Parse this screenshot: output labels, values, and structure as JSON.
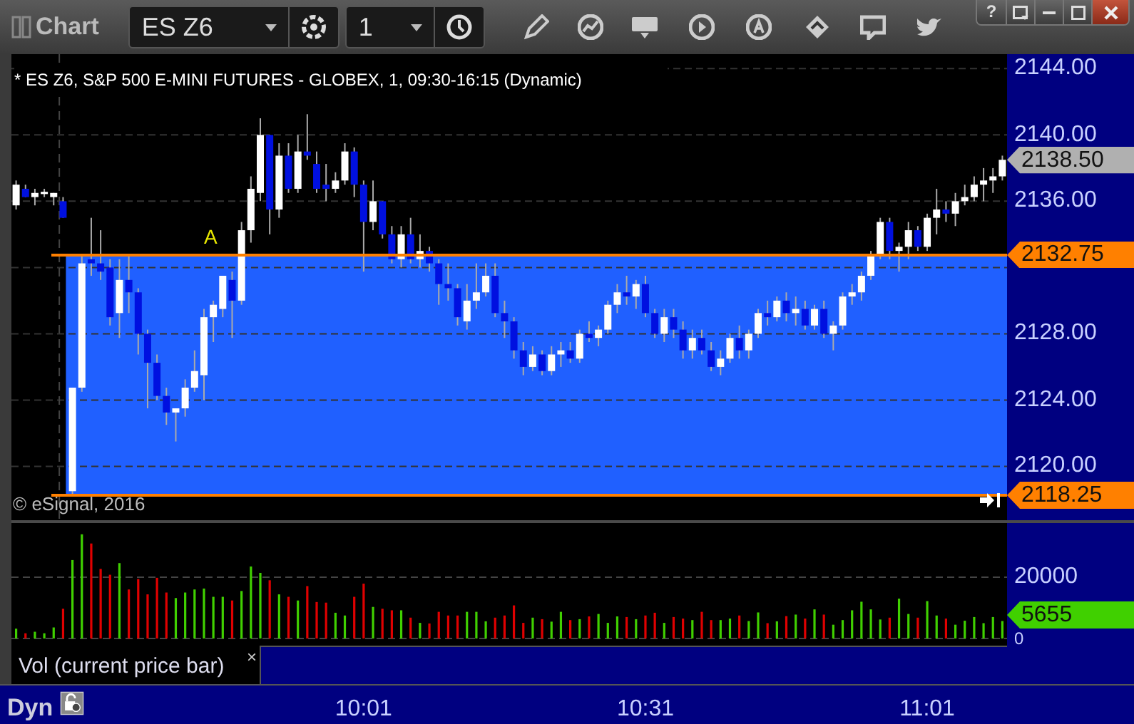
{
  "window": {
    "title": "Chart",
    "help": "?"
  },
  "toolbar": {
    "symbol": "ES Z6",
    "interval": "1"
  },
  "chart": {
    "header": "* ES Z6, S&P 500 E-MINI FUTURES - GLOBEX, 1, 09:30-16:15 (Dynamic)",
    "copyright": "© eSignal, 2016",
    "chart_data": {
      "type": "candlestick",
      "grid": true,
      "categories": [
        null,
        null,
        null,
        null,
        null,
        null,
        null,
        null,
        null,
        null,
        null,
        null,
        null,
        null,
        null,
        null,
        null,
        null,
        null,
        null,
        null,
        null,
        null,
        null,
        null,
        null,
        null,
        null,
        null,
        null,
        null,
        null,
        null,
        null,
        null,
        null,
        null,
        null,
        null,
        null,
        null,
        null,
        null,
        null,
        null,
        null,
        null,
        null,
        null,
        null,
        null,
        null,
        null,
        null,
        null,
        null,
        null,
        null,
        null,
        null,
        null,
        null,
        null,
        null,
        null,
        null,
        null,
        null,
        null,
        null,
        null,
        null,
        null,
        null,
        null,
        null,
        null,
        null,
        null,
        null,
        null,
        null,
        null,
        null,
        null,
        null,
        null,
        null,
        null,
        null,
        null,
        null,
        null,
        null,
        null,
        null,
        null,
        null,
        null,
        null,
        null,
        null,
        null,
        null,
        null,
        null
      ],
      "ohlc": [
        [
          2135.75,
          2137.25,
          2135.5,
          2137
        ],
        [
          2136.75,
          2137,
          2136.25,
          2136.25
        ],
        [
          2136.25,
          2136.75,
          2135.75,
          2136.5
        ],
        [
          2136.5,
          2136.75,
          2136.25,
          2136.5
        ],
        [
          2136.25,
          2136.5,
          2135.75,
          2136.5
        ],
        [
          2136,
          2136.25,
          2135,
          2135
        ],
        [
          2118.5,
          2124.75,
          2118.25,
          2124.75
        ],
        [
          2124.75,
          2132.75,
          2124.5,
          2132.25
        ],
        [
          2132.5,
          2135,
          2131.5,
          2132.25
        ],
        [
          2132.25,
          2134.25,
          2131.25,
          2131.75
        ],
        [
          2132,
          2132.5,
          2128.5,
          2129
        ],
        [
          2129.25,
          2132.5,
          2127.75,
          2131.25
        ],
        [
          2131.25,
          2132.75,
          2129.25,
          2130.5
        ],
        [
          2130.5,
          2130.75,
          2126.75,
          2128
        ],
        [
          2128,
          2128.25,
          2123.5,
          2126.25
        ],
        [
          2126.25,
          2126.75,
          2124,
          2124.25
        ],
        [
          2124.25,
          2124.75,
          2122.5,
          2123.25
        ],
        [
          2123.25,
          2123.5,
          2121.5,
          2123.5
        ],
        [
          2123.5,
          2125.25,
          2123,
          2124.75
        ],
        [
          2124.75,
          2127,
          2124.5,
          2125.75
        ],
        [
          2125.5,
          2129.5,
          2124,
          2129
        ],
        [
          2129,
          2130,
          2127.5,
          2129.75
        ],
        [
          2129.5,
          2131.5,
          2129,
          2131.5
        ],
        [
          2131.25,
          2131.75,
          2127.75,
          2130
        ],
        [
          2130,
          2134.75,
          2129.75,
          2134.25
        ],
        [
          2134.25,
          2137.5,
          2133.5,
          2136.75
        ],
        [
          2136.5,
          2141,
          2136,
          2140
        ],
        [
          2140,
          2140,
          2134,
          2135.5
        ],
        [
          2135.5,
          2139.5,
          2135,
          2138.75
        ],
        [
          2138.75,
          2139.5,
          2136.5,
          2136.75
        ],
        [
          2136.75,
          2140,
          2136.5,
          2139
        ],
        [
          2139,
          2141.25,
          2138.5,
          2138.75
        ],
        [
          2138.25,
          2139,
          2136.5,
          2136.75
        ],
        [
          2137,
          2138.25,
          2136,
          2136.75
        ],
        [
          2136.75,
          2137.75,
          2136.5,
          2137.25
        ],
        [
          2137.25,
          2139.5,
          2137,
          2139
        ],
        [
          2139,
          2139.25,
          2136.25,
          2137
        ],
        [
          2137,
          2137.25,
          2131.75,
          2134.75
        ],
        [
          2134.75,
          2137.25,
          2134.25,
          2136
        ],
        [
          2136,
          2136,
          2133.75,
          2134
        ],
        [
          2134,
          2134.5,
          2132.25,
          2132.5
        ],
        [
          2132.5,
          2134.5,
          2132,
          2134
        ],
        [
          2134,
          2135,
          2132.25,
          2132.5
        ],
        [
          2132.5,
          2134,
          2132,
          2133
        ],
        [
          2133,
          2133.25,
          2131.75,
          2132.25
        ],
        [
          2132.25,
          2132.5,
          2129.75,
          2131
        ],
        [
          2131,
          2132.25,
          2130,
          2130.75
        ],
        [
          2130.75,
          2131,
          2128.5,
          2129
        ],
        [
          2128.75,
          2131,
          2128.25,
          2130
        ],
        [
          2130,
          2132.25,
          2129.5,
          2130.5
        ],
        [
          2130.5,
          2132.25,
          2130.25,
          2131.5
        ],
        [
          2131.5,
          2132.25,
          2129,
          2129.25
        ],
        [
          2129.25,
          2130,
          2127.75,
          2128.75
        ],
        [
          2128.75,
          2129,
          2126.5,
          2127
        ],
        [
          2127,
          2127.5,
          2125.5,
          2126
        ],
        [
          2126,
          2127.25,
          2125.75,
          2126.75
        ],
        [
          2126.75,
          2127,
          2125.5,
          2125.75
        ],
        [
          2125.75,
          2127.25,
          2125.5,
          2126.75
        ],
        [
          2126.75,
          2127.5,
          2126,
          2127
        ],
        [
          2127,
          2127.5,
          2126.25,
          2126.5
        ],
        [
          2126.5,
          2128.25,
          2126.25,
          2128
        ],
        [
          2128,
          2128.75,
          2127.5,
          2127.75
        ],
        [
          2127.75,
          2128.5,
          2127.25,
          2128.25
        ],
        [
          2128.25,
          2130,
          2128,
          2129.75
        ],
        [
          2129.75,
          2131,
          2129.25,
          2130.5
        ],
        [
          2130.5,
          2131.5,
          2129.75,
          2130.25
        ],
        [
          2130.25,
          2131.25,
          2129.5,
          2131
        ],
        [
          2131,
          2131.5,
          2129,
          2129.25
        ],
        [
          2129.25,
          2129.5,
          2127.75,
          2128
        ],
        [
          2128,
          2129.5,
          2127.5,
          2129
        ],
        [
          2129,
          2129.5,
          2127.75,
          2128.25
        ],
        [
          2128.25,
          2128.75,
          2126.5,
          2127
        ],
        [
          2127,
          2128.25,
          2126.5,
          2127.75
        ],
        [
          2127.75,
          2128.25,
          2126.75,
          2127
        ],
        [
          2127,
          2127.5,
          2125.75,
          2126
        ],
        [
          2126,
          2127,
          2125.5,
          2126.5
        ],
        [
          2126.5,
          2128,
          2126.25,
          2127.75
        ],
        [
          2127.75,
          2128.5,
          2126.5,
          2127
        ],
        [
          2127,
          2128.25,
          2126.5,
          2128
        ],
        [
          2128,
          2129.5,
          2127.75,
          2129.25
        ],
        [
          2129.25,
          2130,
          2128.5,
          2129
        ],
        [
          2129,
          2130.25,
          2128.75,
          2130
        ],
        [
          2130,
          2130.5,
          2128.75,
          2129.25
        ],
        [
          2129.25,
          2130.25,
          2128.5,
          2129.5
        ],
        [
          2129.5,
          2130,
          2128.25,
          2128.5
        ],
        [
          2128.5,
          2129.75,
          2128.25,
          2129.5
        ],
        [
          2129.5,
          2130,
          2127.75,
          2128
        ],
        [
          2128,
          2128.75,
          2127,
          2128.5
        ],
        [
          2128.5,
          2130.5,
          2128.25,
          2130.25
        ],
        [
          2130.25,
          2131,
          2129.75,
          2130.5
        ],
        [
          2130.5,
          2131.75,
          2130,
          2131.5
        ],
        [
          2131.5,
          2133,
          2131.25,
          2132.75
        ],
        [
          2132.75,
          2135,
          2132.5,
          2134.75
        ],
        [
          2134.75,
          2135,
          2132.5,
          2133
        ],
        [
          2133,
          2133.5,
          2131.75,
          2133.25
        ],
        [
          2133.25,
          2134.75,
          2132.5,
          2134.25
        ],
        [
          2134.25,
          2134.5,
          2133,
          2133.25
        ],
        [
          2133.25,
          2135.25,
          2133,
          2135
        ],
        [
          2135,
          2136.75,
          2134,
          2135.5
        ],
        [
          2135.5,
          2136,
          2134.75,
          2135.25
        ],
        [
          2135.25,
          2136.5,
          2134.5,
          2136
        ],
        [
          2136,
          2137,
          2135.75,
          2136.25
        ],
        [
          2136.25,
          2137.5,
          2136,
          2137
        ],
        [
          2137,
          2138,
          2136,
          2137.25
        ],
        [
          2137.25,
          2138,
          2136.5,
          2137.5
        ],
        [
          2137.5,
          2138.75,
          2137.25,
          2138.5
        ]
      ],
      "ylim": [
        2116.75,
        2144.875
      ],
      "yticks": [
        {
          "value": 2144,
          "label": "2144.00"
        },
        {
          "value": 2140,
          "label": "2140.00"
        },
        {
          "value": 2136,
          "label": "2136.00"
        },
        {
          "value": 2128,
          "label": "2128.00"
        },
        {
          "value": 2124,
          "label": "2124.00"
        },
        {
          "value": 2120,
          "label": "2120.00"
        }
      ],
      "ref_lines": [
        {
          "axis": "y",
          "value": 2132.75,
          "label": "2132.75"
        },
        {
          "axis": "y",
          "value": 2118.25,
          "label": "2118.25"
        }
      ],
      "annotations": [
        "A"
      ]
    },
    "price_markers": [
      {
        "label": "2138.50",
        "kind": "last"
      }
    ]
  },
  "volume": {
    "chart_data": {
      "type": "bar",
      "grid": true,
      "categories": [
        null,
        null,
        null,
        null,
        null,
        null,
        null,
        null,
        null,
        null,
        null,
        null,
        null,
        null,
        null,
        null,
        null,
        null,
        null,
        null,
        null,
        null,
        null,
        null,
        null,
        null,
        null,
        null,
        null,
        null,
        null,
        null,
        null,
        null,
        null,
        null,
        null,
        "10:01",
        null,
        null,
        null,
        null,
        null,
        null,
        null,
        null,
        null,
        null,
        null,
        null,
        null,
        null,
        null,
        null,
        null,
        null,
        null,
        null,
        null,
        null,
        null,
        null,
        null,
        null,
        null,
        null,
        null,
        "10:31",
        null,
        null,
        null,
        null,
        null,
        null,
        null,
        null,
        null,
        null,
        null,
        null,
        null,
        null,
        null,
        null,
        null,
        null,
        null,
        null,
        null,
        null,
        null,
        null,
        null,
        null,
        null,
        null,
        null,
        "11:01",
        null,
        null,
        null,
        null,
        null,
        null,
        null,
        null
      ],
      "series": [
        {
          "name": "Vol (current price bar)",
          "values": [
            3200,
            1700,
            2200,
            1700,
            3600,
            9700,
            25600,
            34000,
            31000,
            22700,
            20800,
            24600,
            16000,
            19400,
            14400,
            19800,
            15000,
            13200,
            15000,
            16000,
            16300,
            13600,
            13600,
            12400,
            15500,
            23500,
            21400,
            19000,
            14400,
            13600,
            12400,
            17100,
            11900,
            11700,
            8400,
            7500,
            13600,
            17900,
            10300,
            9700,
            9200,
            9200,
            6800,
            5100,
            4900,
            8700,
            7500,
            7500,
            8700,
            8700,
            5600,
            6800,
            7500,
            10800,
            5100,
            6800,
            6300,
            5500,
            8700,
            6000,
            6300,
            7200,
            8000,
            5100,
            7200,
            7000,
            6300,
            7500,
            8400,
            5100,
            7000,
            6500,
            6000,
            8700,
            6000,
            6000,
            6500,
            7500,
            5700,
            8500,
            5000,
            5600,
            7300,
            7800,
            6500,
            9500,
            7800,
            4500,
            6000,
            9200,
            12000,
            9500,
            6200,
            6800,
            13000,
            8000,
            6800,
            12200,
            7500,
            6500,
            4500,
            5800,
            7000,
            5000,
            7000,
            5700
          ]
        }
      ],
      "ylim": [
        0,
        38140
      ],
      "yticks": [
        {
          "value": 20000,
          "label": "20000"
        },
        {
          "value": 0,
          "label": "0"
        }
      ]
    },
    "marker": "5655",
    "close": "×"
  },
  "time_axis": {
    "mode": "Dyn"
  }
}
